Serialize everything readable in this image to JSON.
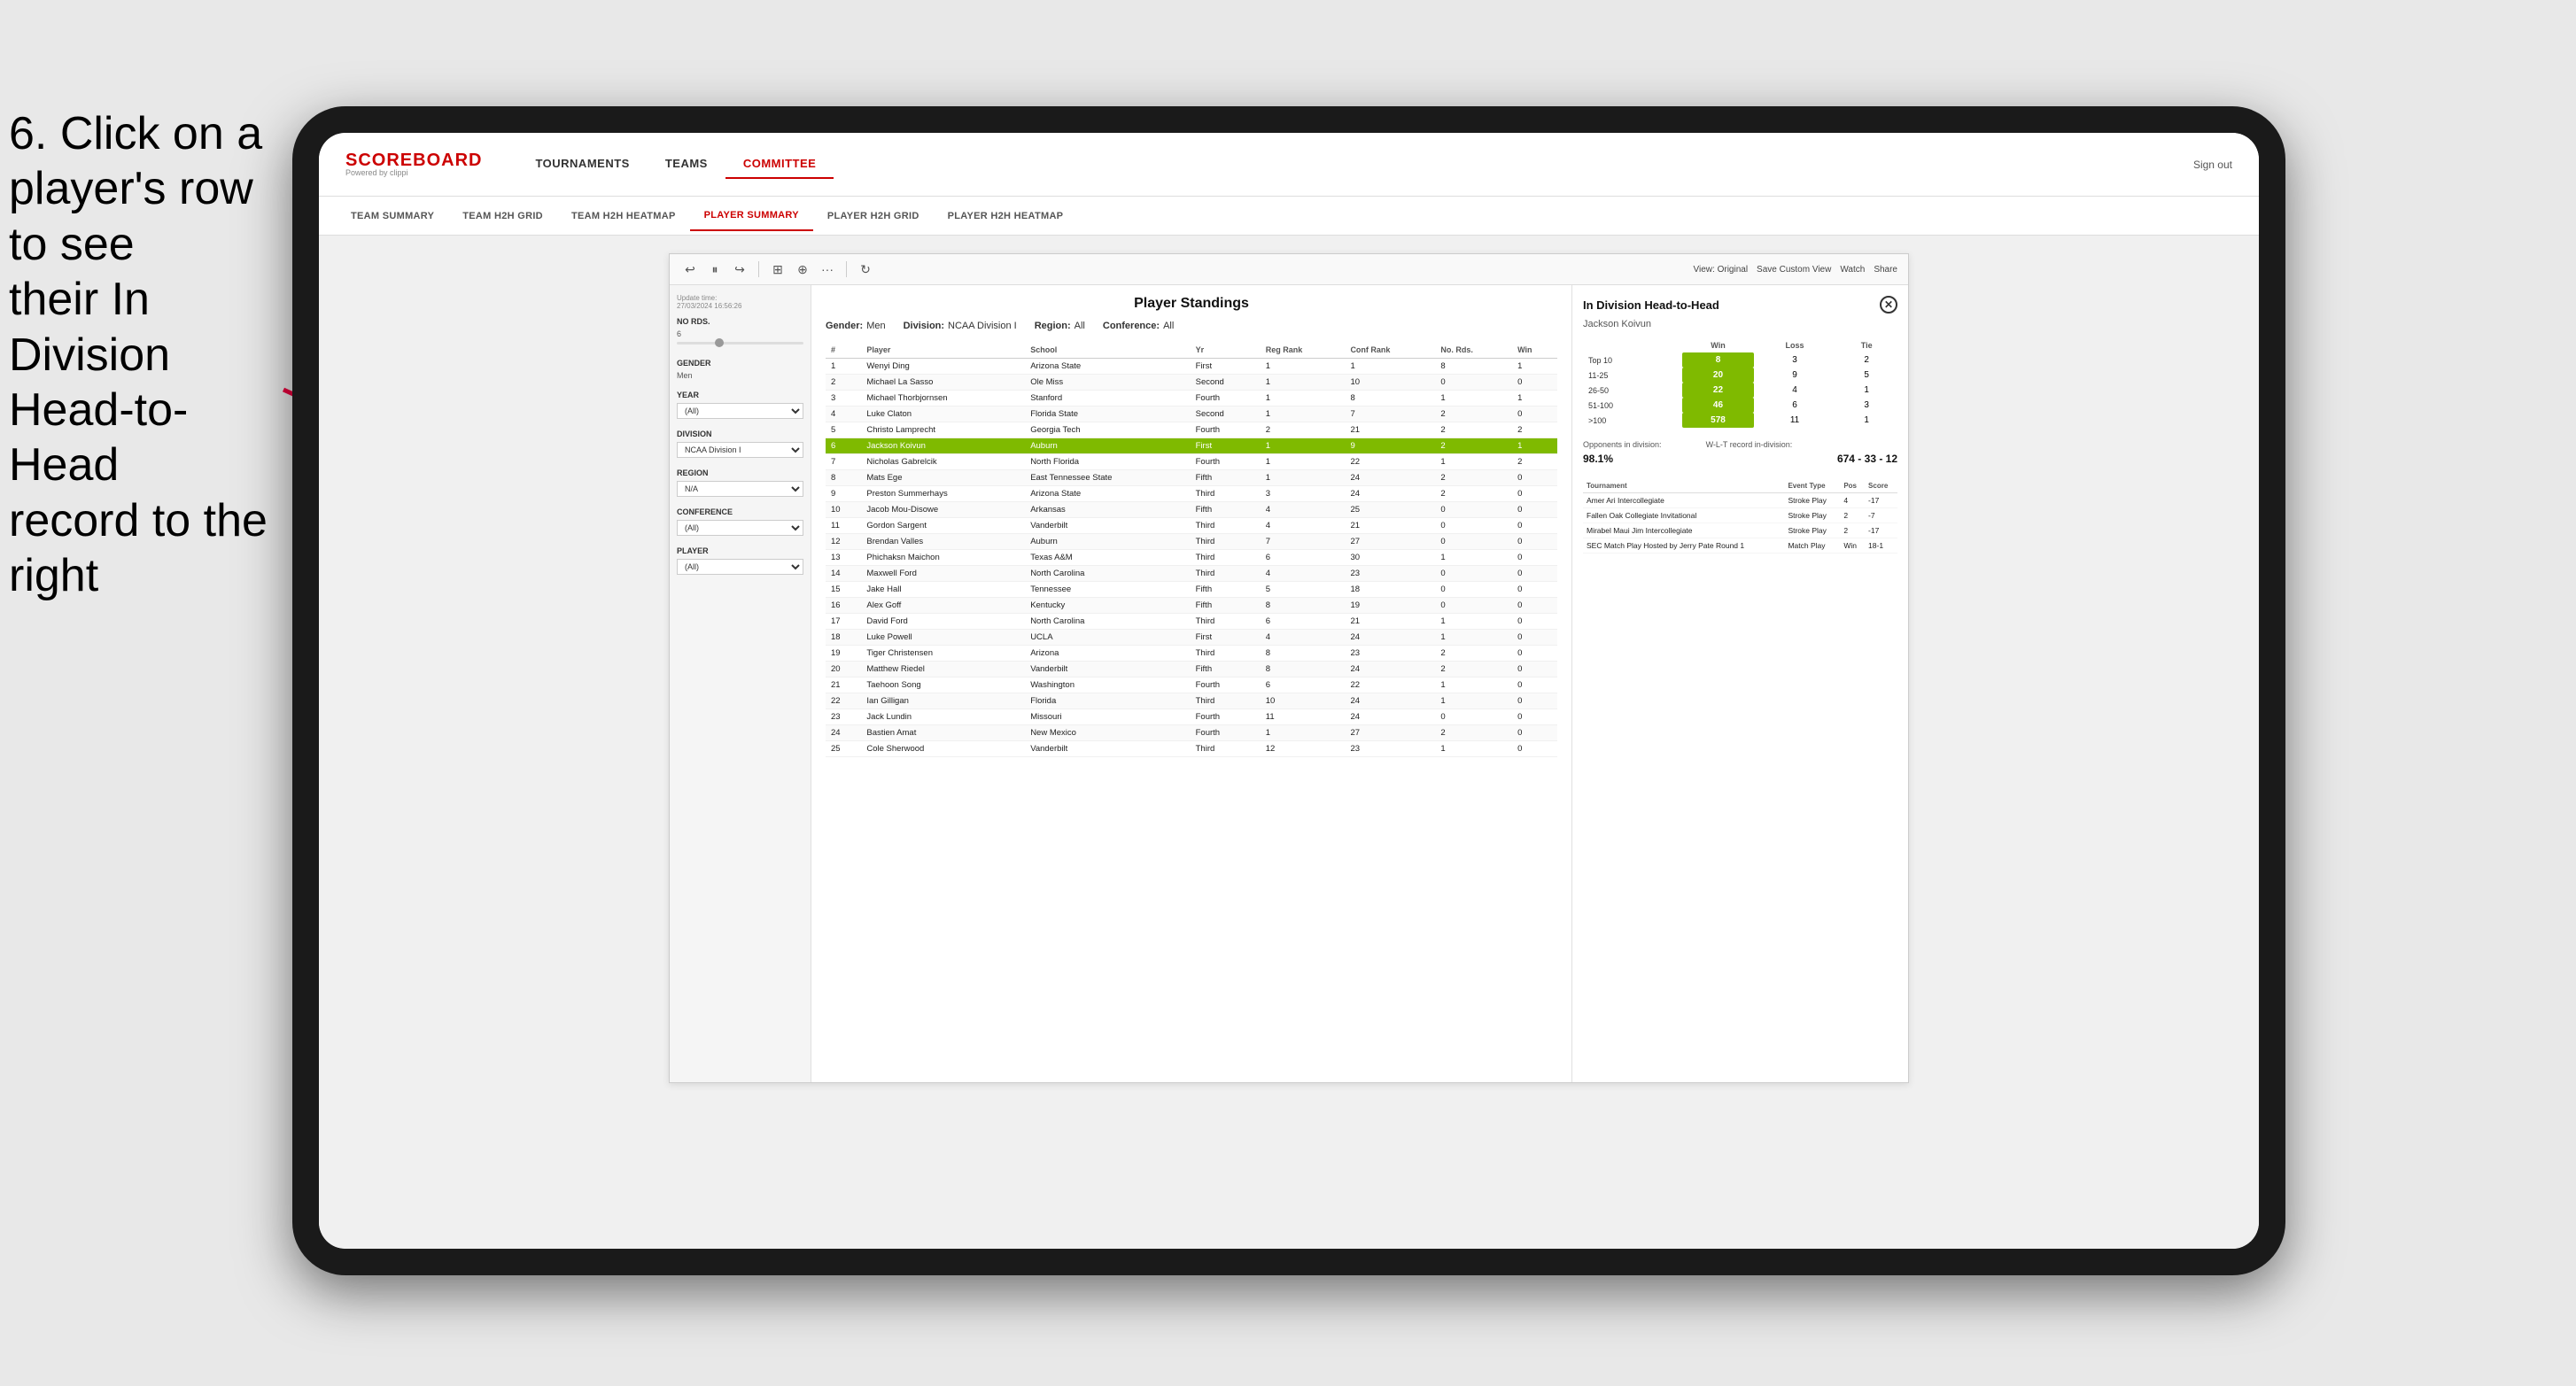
{
  "instruction": {
    "line1": "6. Click on a",
    "line2": "player's row to see",
    "line3": "their In Division",
    "line4": "Head-to-Head",
    "line5": "record to the right"
  },
  "nav": {
    "logo": "SCOREBOARD",
    "logo_sub": "Powered by clippi",
    "items": [
      "TOURNAMENTS",
      "TEAMS",
      "COMMITTEE"
    ],
    "sign_out": "Sign out"
  },
  "sub_nav": {
    "items": [
      "TEAM SUMMARY",
      "TEAM H2H GRID",
      "TEAM H2H HEATMAP",
      "PLAYER SUMMARY",
      "PLAYER H2H GRID",
      "PLAYER H2H HEATMAP"
    ],
    "active": "PLAYER SUMMARY"
  },
  "report": {
    "update_time_label": "Update time:",
    "update_time": "27/03/2024 16:56:26",
    "title": "Player Standings",
    "filters": {
      "gender_label": "Gender:",
      "gender": "Men",
      "division_label": "Division:",
      "division": "NCAA Division I",
      "region_label": "Region:",
      "region": "All",
      "conference_label": "Conference:",
      "conference": "All"
    }
  },
  "filter_panel": {
    "no_rds_label": "No Rds.",
    "no_rds_value": "6",
    "gender_label": "Gender",
    "gender_value": "Men",
    "year_label": "Year",
    "year_value": "(All)",
    "division_label": "Division",
    "division_value": "NCAA Division I",
    "region_label": "Region",
    "region_value": "N/A",
    "conference_label": "Conference",
    "conference_value": "(All)",
    "player_label": "Player",
    "player_value": "(All)"
  },
  "table": {
    "headers": [
      "#",
      "Player",
      "School",
      "Yr",
      "Reg Rank",
      "Conf Rank",
      "No. Rds.",
      "Win"
    ],
    "rows": [
      {
        "num": "1",
        "player": "Wenyi Ding",
        "school": "Arizona State",
        "yr": "First",
        "reg": "1",
        "conf": "1",
        "rds": "8",
        "win": "1"
      },
      {
        "num": "2",
        "player": "Michael La Sasso",
        "school": "Ole Miss",
        "yr": "Second",
        "reg": "1",
        "conf": "10",
        "rds": "0",
        "win": "0"
      },
      {
        "num": "3",
        "player": "Michael Thorbjornsen",
        "school": "Stanford",
        "yr": "Fourth",
        "reg": "1",
        "conf": "8",
        "rds": "1",
        "win": "1"
      },
      {
        "num": "4",
        "player": "Luke Claton",
        "school": "Florida State",
        "yr": "Second",
        "reg": "1",
        "conf": "7",
        "rds": "2",
        "win": "0"
      },
      {
        "num": "5",
        "player": "Christo Lamprecht",
        "school": "Georgia Tech",
        "yr": "Fourth",
        "reg": "2",
        "conf": "21",
        "rds": "2",
        "win": "2"
      },
      {
        "num": "6",
        "player": "Jackson Koivun",
        "school": "Auburn",
        "yr": "First",
        "reg": "1",
        "conf": "9",
        "rds": "2",
        "win": "1",
        "highlighted": true
      },
      {
        "num": "7",
        "player": "Nicholas Gabrelcik",
        "school": "North Florida",
        "yr": "Fourth",
        "reg": "1",
        "conf": "22",
        "rds": "1",
        "win": "2"
      },
      {
        "num": "8",
        "player": "Mats Ege",
        "school": "East Tennessee State",
        "yr": "Fifth",
        "reg": "1",
        "conf": "24",
        "rds": "2",
        "win": "0"
      },
      {
        "num": "9",
        "player": "Preston Summerhays",
        "school": "Arizona State",
        "yr": "Third",
        "reg": "3",
        "conf": "24",
        "rds": "2",
        "win": "0"
      },
      {
        "num": "10",
        "player": "Jacob Mou-Disowe",
        "school": "Arkansas",
        "yr": "Fifth",
        "reg": "4",
        "conf": "25",
        "rds": "0",
        "win": "0"
      },
      {
        "num": "11",
        "player": "Gordon Sargent",
        "school": "Vanderbilt",
        "yr": "Third",
        "reg": "4",
        "conf": "21",
        "rds": "0",
        "win": "0"
      },
      {
        "num": "12",
        "player": "Brendan Valles",
        "school": "Auburn",
        "yr": "Third",
        "reg": "7",
        "conf": "27",
        "rds": "0",
        "win": "0"
      },
      {
        "num": "13",
        "player": "Phichaksn Maichon",
        "school": "Texas A&M",
        "yr": "Third",
        "reg": "6",
        "conf": "30",
        "rds": "1",
        "win": "0"
      },
      {
        "num": "14",
        "player": "Maxwell Ford",
        "school": "North Carolina",
        "yr": "Third",
        "reg": "4",
        "conf": "23",
        "rds": "0",
        "win": "0"
      },
      {
        "num": "15",
        "player": "Jake Hall",
        "school": "Tennessee",
        "yr": "Fifth",
        "reg": "5",
        "conf": "18",
        "rds": "0",
        "win": "0"
      },
      {
        "num": "16",
        "player": "Alex Goff",
        "school": "Kentucky",
        "yr": "Fifth",
        "reg": "8",
        "conf": "19",
        "rds": "0",
        "win": "0"
      },
      {
        "num": "17",
        "player": "David Ford",
        "school": "North Carolina",
        "yr": "Third",
        "reg": "6",
        "conf": "21",
        "rds": "1",
        "win": "0"
      },
      {
        "num": "18",
        "player": "Luke Powell",
        "school": "UCLA",
        "yr": "First",
        "reg": "4",
        "conf": "24",
        "rds": "1",
        "win": "0"
      },
      {
        "num": "19",
        "player": "Tiger Christensen",
        "school": "Arizona",
        "yr": "Third",
        "reg": "8",
        "conf": "23",
        "rds": "2",
        "win": "0"
      },
      {
        "num": "20",
        "player": "Matthew Riedel",
        "school": "Vanderbilt",
        "yr": "Fifth",
        "reg": "8",
        "conf": "24",
        "rds": "2",
        "win": "0"
      },
      {
        "num": "21",
        "player": "Taehoon Song",
        "school": "Washington",
        "yr": "Fourth",
        "reg": "6",
        "conf": "22",
        "rds": "1",
        "win": "0"
      },
      {
        "num": "22",
        "player": "Ian Gilligan",
        "school": "Florida",
        "yr": "Third",
        "reg": "10",
        "conf": "24",
        "rds": "1",
        "win": "0"
      },
      {
        "num": "23",
        "player": "Jack Lundin",
        "school": "Missouri",
        "yr": "Fourth",
        "reg": "11",
        "conf": "24",
        "rds": "0",
        "win": "0"
      },
      {
        "num": "24",
        "player": "Bastien Amat",
        "school": "New Mexico",
        "yr": "Fourth",
        "reg": "1",
        "conf": "27",
        "rds": "2",
        "win": "0"
      },
      {
        "num": "25",
        "player": "Cole Sherwood",
        "school": "Vanderbilt",
        "yr": "Third",
        "reg": "12",
        "conf": "23",
        "rds": "1",
        "win": "0"
      }
    ]
  },
  "h2h": {
    "title": "In Division Head-to-Head",
    "player": "Jackson Koivun",
    "ranking_headers": [
      "",
      "Win",
      "Loss",
      "Tie"
    ],
    "ranking_rows": [
      {
        "range": "Top 10",
        "win": "8",
        "loss": "3",
        "tie": "2"
      },
      {
        "range": "11-25",
        "win": "20",
        "loss": "9",
        "tie": "5"
      },
      {
        "range": "26-50",
        "win": "22",
        "loss": "4",
        "tie": "1"
      },
      {
        "range": "51-100",
        "win": "46",
        "loss": "6",
        "tie": "3"
      },
      {
        "range": ">100",
        "win": "578",
        "loss": "11",
        "tie": "1"
      }
    ],
    "opponents_pct_label": "Opponents in division:",
    "opponents_pct": "98.1%",
    "wl_label": "W-L-T record in-division:",
    "wl_record": "674 - 33 - 12",
    "tournament_headers": [
      "Tournament",
      "Event Type",
      "Pos",
      "Score"
    ],
    "tournament_rows": [
      {
        "name": "Amer Ari Intercollegiate",
        "type": "Stroke Play",
        "pos": "4",
        "score": "-17"
      },
      {
        "name": "Fallen Oak Collegiate Invitational",
        "type": "Stroke Play",
        "pos": "2",
        "score": "-7"
      },
      {
        "name": "Mirabel Maui Jim Intercollegiate",
        "type": "Stroke Play",
        "pos": "2",
        "score": "-17"
      },
      {
        "name": "SEC Match Play Hosted by Jerry Pate Round 1",
        "type": "Match Play",
        "pos": "Win",
        "score": "18-1"
      }
    ]
  },
  "toolbar": {
    "view_label": "View: Original",
    "save_label": "Save Custom View",
    "watch_label": "Watch",
    "share_label": "Share"
  }
}
